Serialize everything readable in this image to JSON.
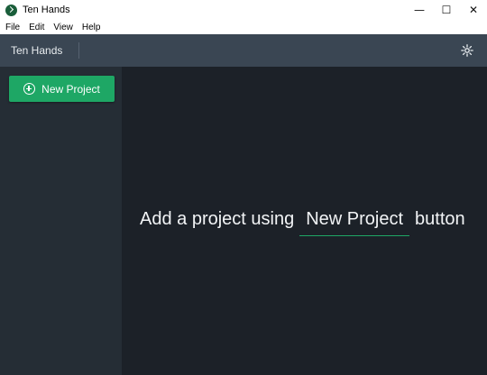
{
  "window": {
    "title": "Ten Hands",
    "minimize_glyph": "—",
    "maximize_glyph": "☐",
    "close_glyph": "✕"
  },
  "menu": {
    "items": [
      {
        "label": "File"
      },
      {
        "label": "Edit"
      },
      {
        "label": "View"
      },
      {
        "label": "Help"
      }
    ]
  },
  "header": {
    "title": "Ten Hands",
    "settings_icon": "gear-icon"
  },
  "sidebar": {
    "new_project_label": "New Project",
    "new_project_icon": "plus-circle-icon"
  },
  "main": {
    "empty_prefix": "Add a project using",
    "empty_button": "New Project",
    "empty_suffix": "button"
  },
  "colors": {
    "accent": "#1ea765",
    "header_bg": "#3a4653",
    "sidebar_bg": "#252d35",
    "main_bg": "#1c2128"
  }
}
